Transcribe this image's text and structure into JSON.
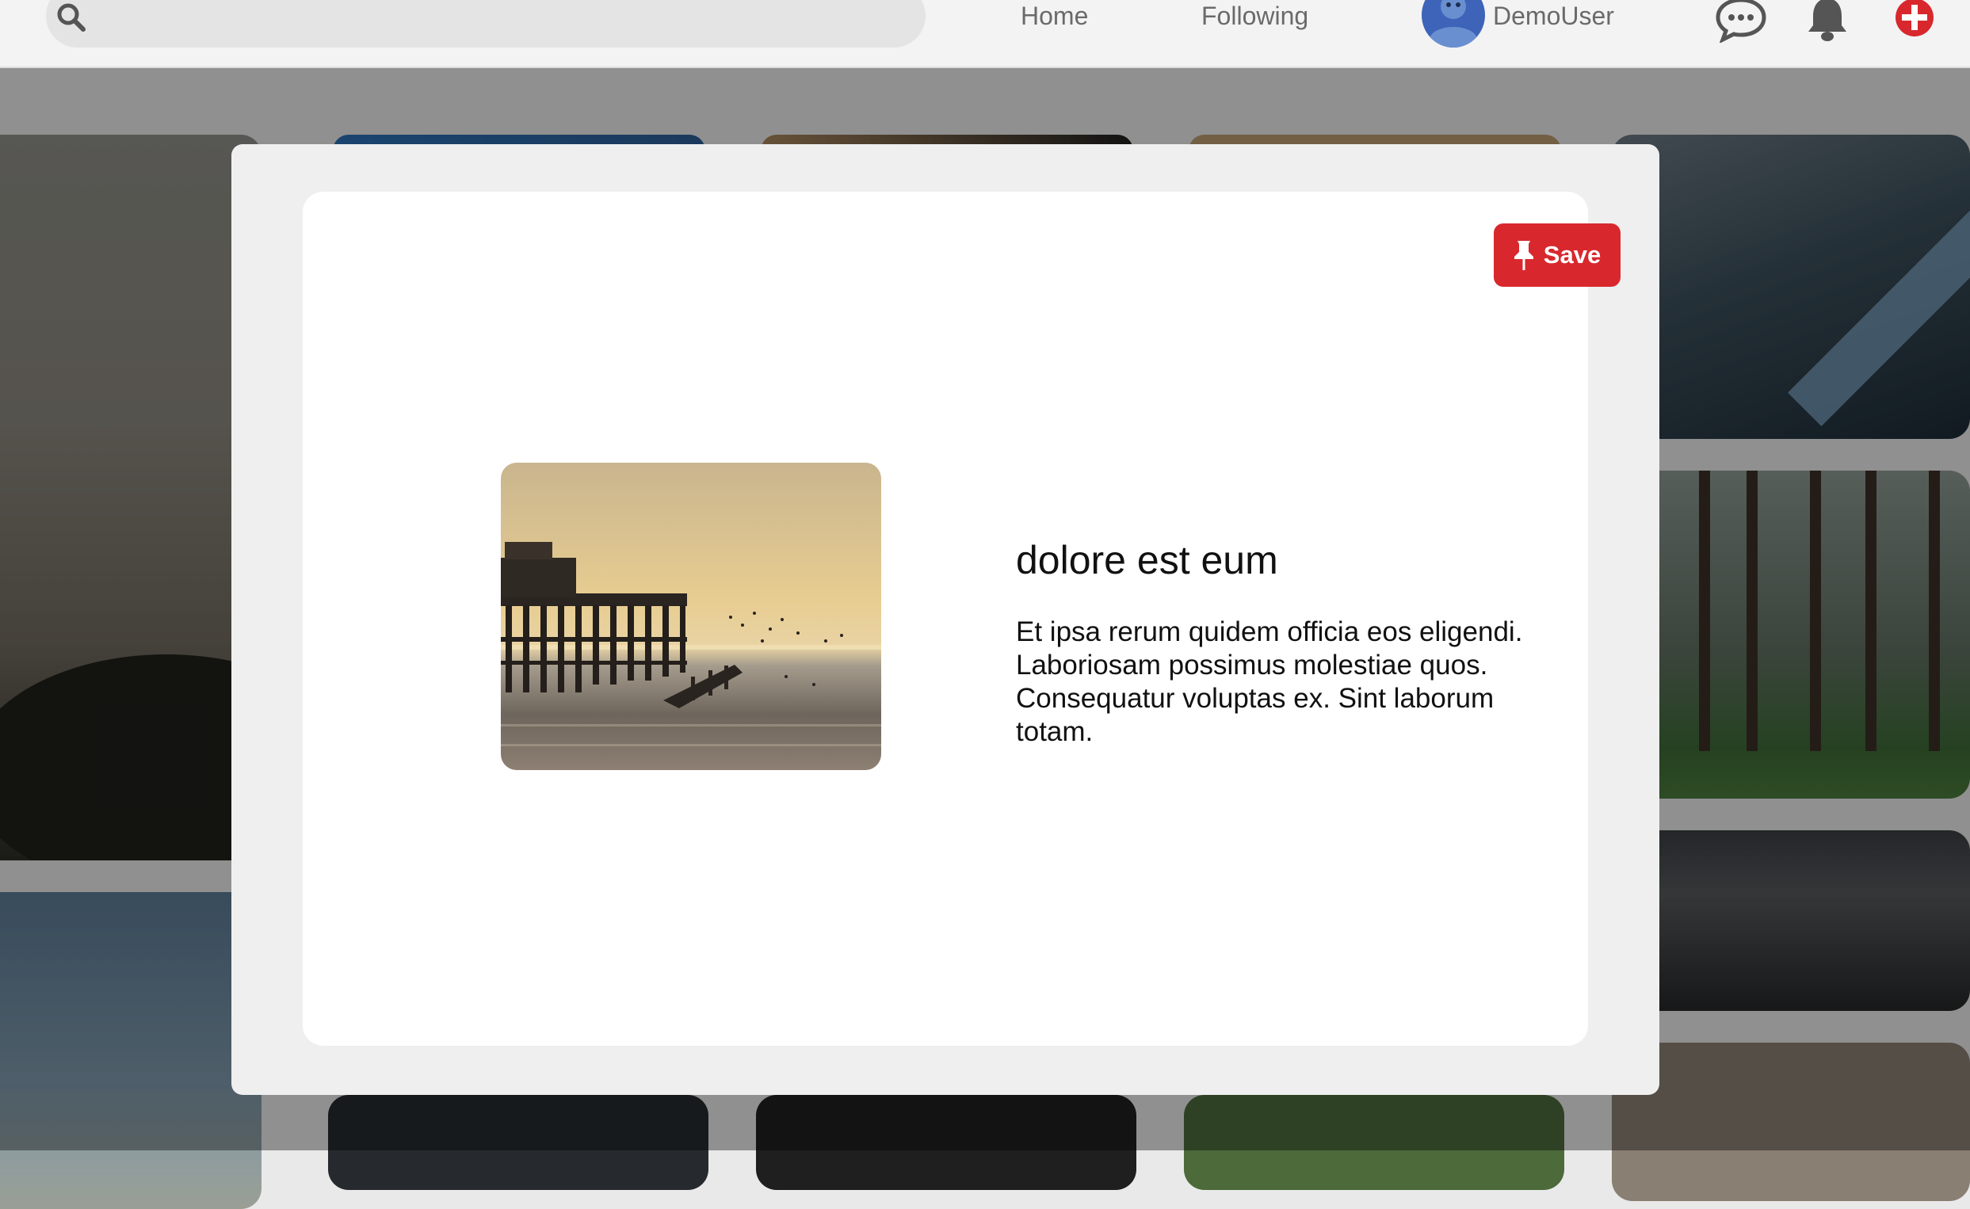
{
  "header": {
    "nav": [
      {
        "label": "Home"
      },
      {
        "label": "Following"
      }
    ],
    "user": {
      "name": "DemoUser"
    },
    "icons": [
      "search-icon",
      "chat-icon",
      "bell-icon",
      "add-icon"
    ],
    "colors": {
      "accent": "#d8282e",
      "avatar": "#3d64b8"
    }
  },
  "modal": {
    "save_label": "Save",
    "pin": {
      "title": "dolore est eum",
      "description": "Et ipsa rerum quidem officia eos eligendi. Laboriosam possimus molestiae quos. Consequatur voluptas ex. Sint laborum totam."
    }
  }
}
